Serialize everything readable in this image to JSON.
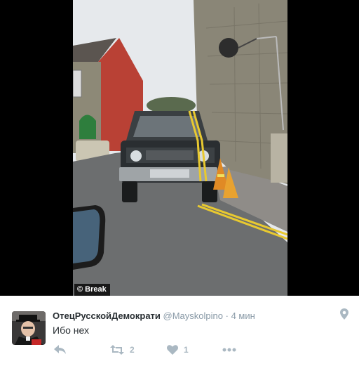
{
  "media": {
    "credit": "© Break"
  },
  "tweet": {
    "display_name": "ОтецРусскойДемократи",
    "handle": "@Mayskolpino",
    "separator": "·",
    "time": "4 мин",
    "text": "Ибо нех",
    "retweet_count": "2",
    "like_count": "1"
  },
  "icons": {
    "location": "location-pin-icon",
    "reply": "reply-icon",
    "retweet": "retweet-icon",
    "like": "heart-icon",
    "more": "more-dots-icon"
  },
  "colors": {
    "text_primary": "#292f33",
    "text_secondary": "#8899a6",
    "icon_gray": "#aab8c2"
  }
}
